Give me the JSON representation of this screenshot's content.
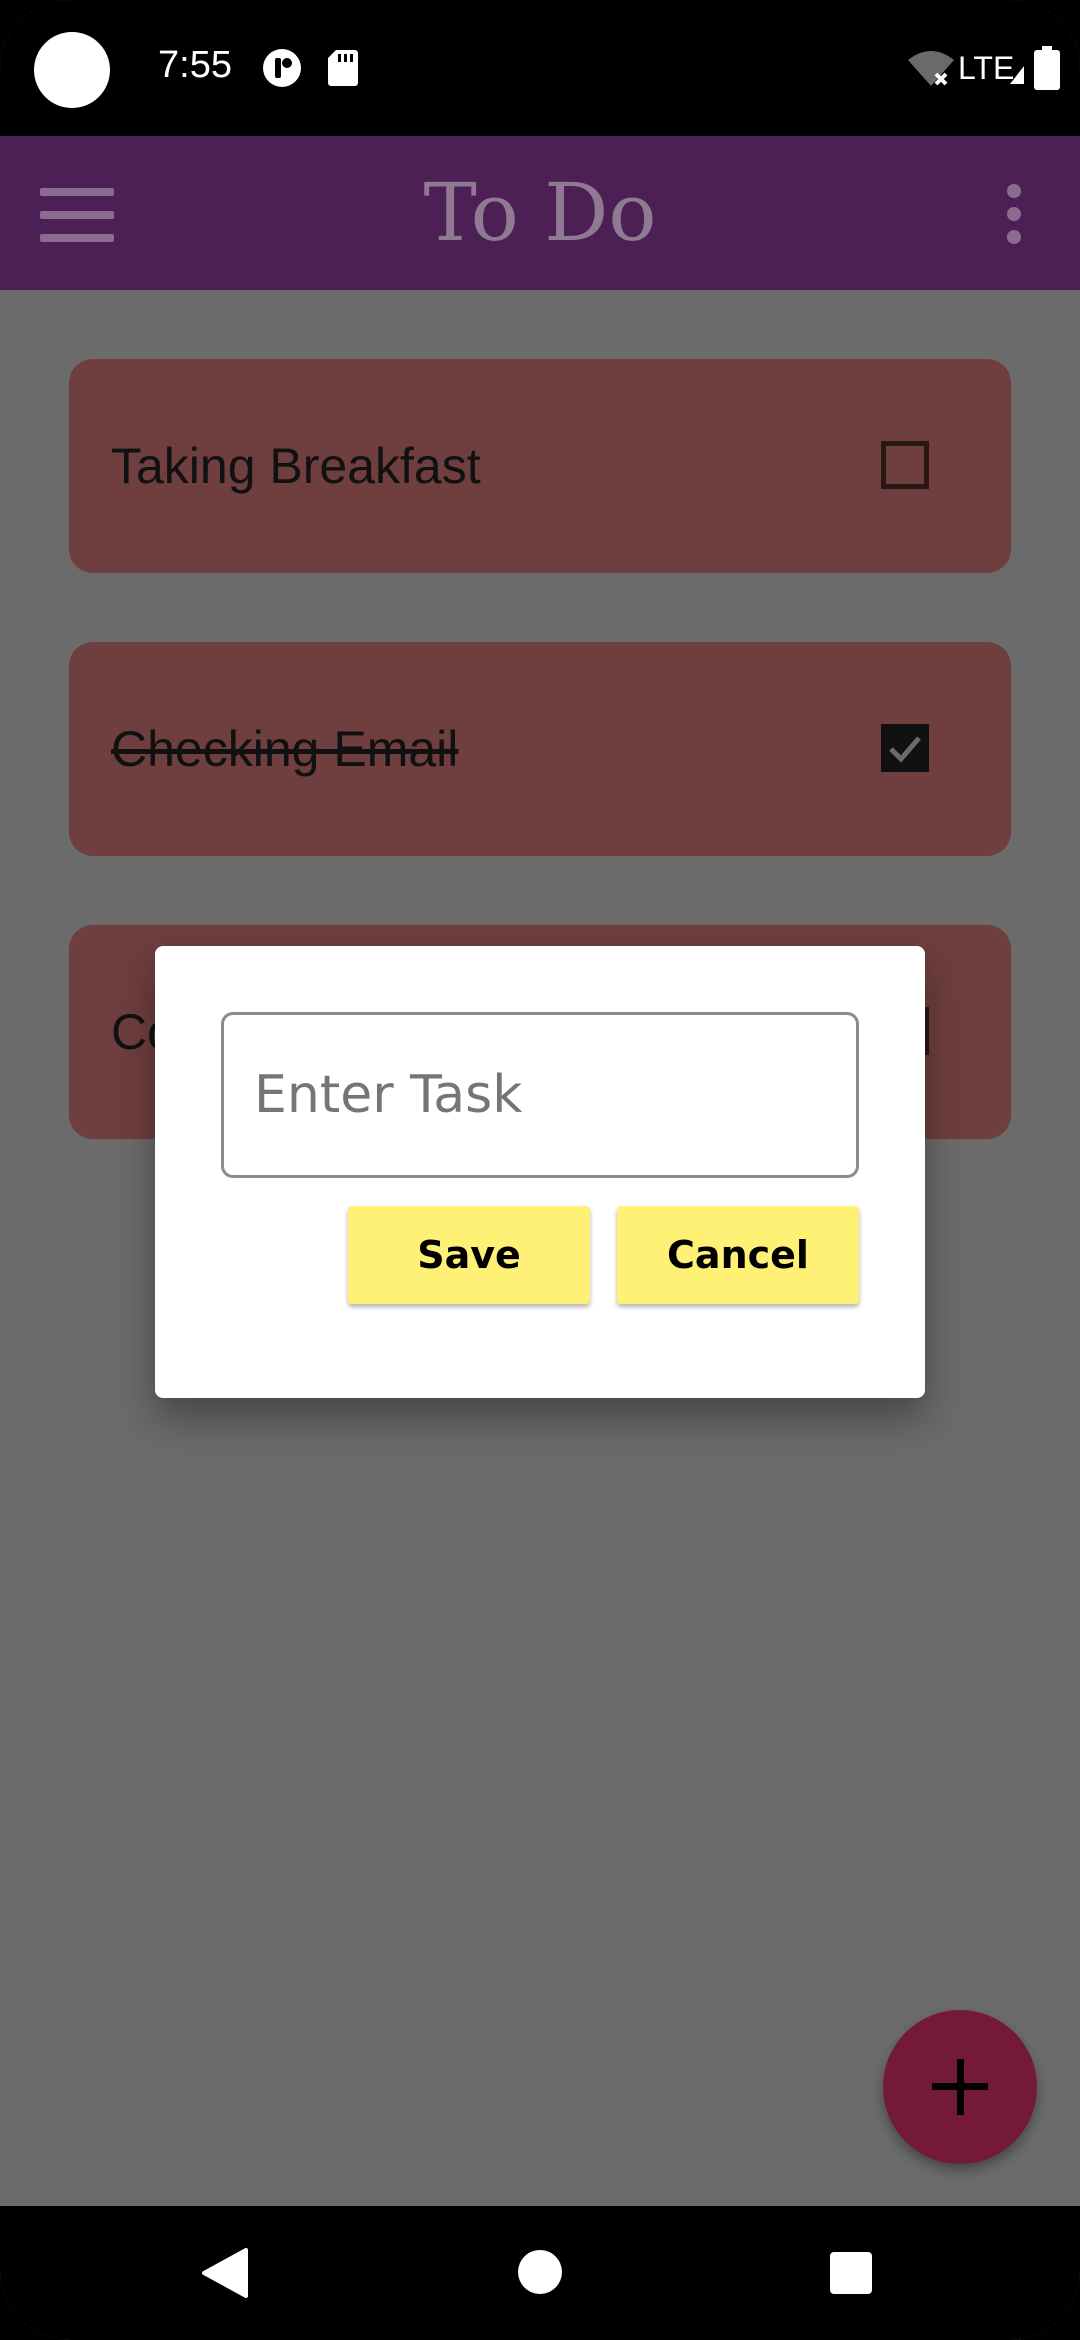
{
  "status_bar": {
    "time": "7:55",
    "network": "LTE",
    "icons": [
      "camera-cutout-icon",
      "app-notification-icon",
      "sd-card-icon",
      "wifi-off-icon",
      "signal-icon",
      "battery-icon"
    ]
  },
  "app_bar": {
    "title": "To Do",
    "menu_icon": "hamburger-menu-icon",
    "overflow_icon": "more-vert-icon"
  },
  "tasks": [
    {
      "label": "Taking Breakfast",
      "done": false
    },
    {
      "label": "Checking Email",
      "done": true
    },
    {
      "label": "Co",
      "done": false
    }
  ],
  "dialog": {
    "input_placeholder": "Enter Task",
    "input_value": "",
    "save_label": "Save",
    "cancel_label": "Cancel"
  },
  "fab": {
    "icon": "plus-icon"
  },
  "nav_bar": {
    "icons": [
      "back-icon",
      "home-icon",
      "recents-icon"
    ]
  },
  "colors": {
    "app_bar": "#4c2055",
    "card": "#6f3e3e",
    "dialog_button": "#fff176",
    "fab": "#74193a",
    "scrim_background": "#6b6b6b"
  }
}
